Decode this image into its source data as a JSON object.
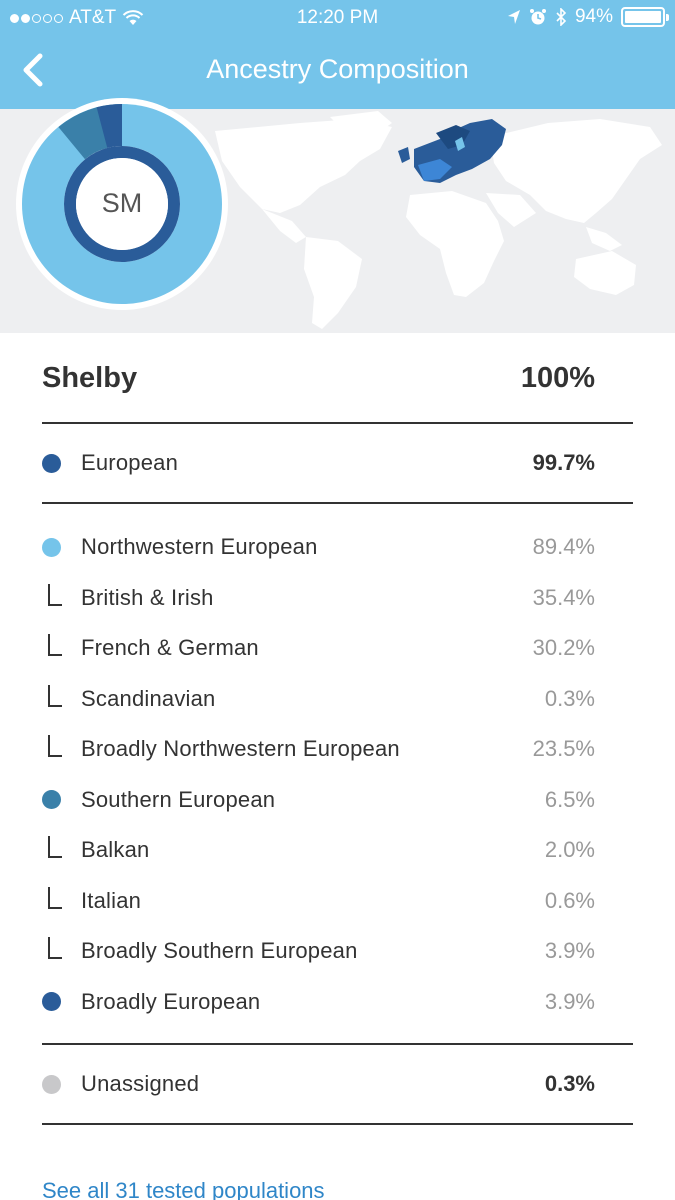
{
  "status_bar": {
    "carrier": "AT&T",
    "time": "12:20 PM",
    "battery": "94%"
  },
  "nav": {
    "title": "Ancestry Composition",
    "back_icon": "chevron-left-icon"
  },
  "avatar": {
    "initials": "SM"
  },
  "colors": {
    "header": "#75c4ea",
    "european": "#2a5c99",
    "northwestern": "#75c4ea",
    "southern": "#3a80a9",
    "broadly_european": "#2a5c99",
    "unassigned": "#c8c8ca",
    "link": "#2f86c8"
  },
  "summary": {
    "name": "Shelby",
    "percent": "100%"
  },
  "european": {
    "label": "European",
    "percent": "99.7%"
  },
  "populations": [
    {
      "label": "Northwestern European",
      "percent": "89.4%",
      "kind": "dot",
      "color": "#75c4ea"
    },
    {
      "label": "British & Irish",
      "percent": "35.4%",
      "kind": "sub"
    },
    {
      "label": "French & German",
      "percent": "30.2%",
      "kind": "sub"
    },
    {
      "label": "Scandinavian",
      "percent": "0.3%",
      "kind": "sub"
    },
    {
      "label": "Broadly Northwestern European",
      "percent": "23.5%",
      "kind": "sub"
    },
    {
      "label": "Southern European",
      "percent": "6.5%",
      "kind": "dot",
      "color": "#3a80a9"
    },
    {
      "label": "Balkan",
      "percent": "2.0%",
      "kind": "sub"
    },
    {
      "label": "Italian",
      "percent": "0.6%",
      "kind": "sub"
    },
    {
      "label": "Broadly Southern European",
      "percent": "3.9%",
      "kind": "sub"
    },
    {
      "label": "Broadly European",
      "percent": "3.9%",
      "kind": "dot",
      "color": "#2a5c99"
    }
  ],
  "unassigned": {
    "label": "Unassigned",
    "percent": "0.3%"
  },
  "link": {
    "label": "See all 31 tested populations"
  }
}
